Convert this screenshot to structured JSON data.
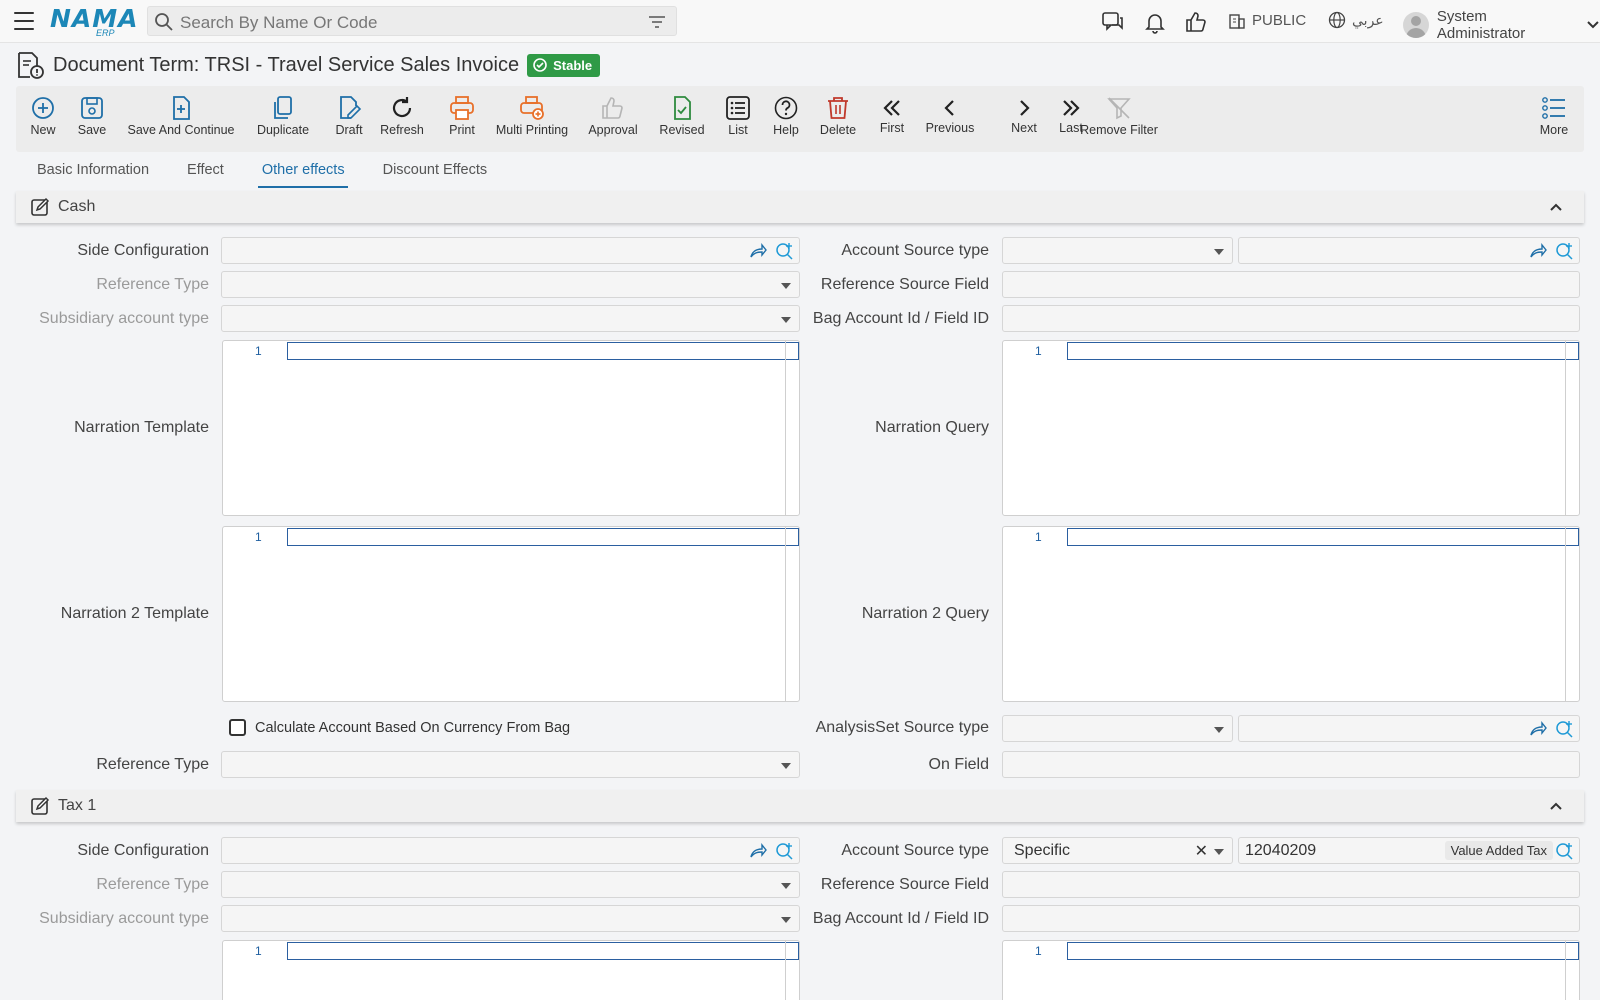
{
  "topbar": {
    "logo_text": "NAMA",
    "logo_sub": "ERP",
    "search_placeholder": "Search By Name Or Code",
    "company": "PUBLIC",
    "language": "عربي",
    "user_name": "System Administrator"
  },
  "page": {
    "title": "Document Term: TRSI - Travel Service Sales Invoice",
    "status": "Stable"
  },
  "toolbar": {
    "new": "New",
    "save": "Save",
    "save_continue": "Save And Continue",
    "duplicate": "Duplicate",
    "draft": "Draft",
    "refresh": "Refresh",
    "print": "Print",
    "multi_printing": "Multi Printing",
    "approval": "Approval",
    "revised": "Revised",
    "list": "List",
    "help": "Help",
    "delete": "Delete",
    "first": "First",
    "previous": "Previous",
    "next": "Next",
    "last": "Last",
    "remove_filter": "Remove Filter",
    "more": "More"
  },
  "tabs": [
    "Basic Information",
    "Effect",
    "Other effects",
    "Discount Effects"
  ],
  "cash": {
    "title": "Cash",
    "side_configuration": "Side Configuration",
    "reference_type": "Reference Type",
    "subsidiary_account_type": "Subsidiary account type",
    "narration_template": "Narration Template",
    "narration2_template": "Narration 2 Template",
    "calc_account_currency": "Calculate Account Based On Currency From Bag",
    "reference_type_2": "Reference Type",
    "account_source_type": "Account Source type",
    "reference_source_field": "Reference Source Field",
    "bag_account_id": "Bag Account Id / Field ID",
    "narration_query": "Narration Query",
    "narration2_query": "Narration 2 Query",
    "analysis_set_source_type": "AnalysisSet Source type",
    "on_field": "On Field",
    "line_no": "1"
  },
  "tax1": {
    "title": "Tax 1",
    "side_configuration": "Side Configuration",
    "reference_type": "Reference Type",
    "subsidiary_account_type": "Subsidiary account type",
    "account_source_type": "Account Source type",
    "account_source_value": "Specific",
    "account_code": "12040209",
    "account_name": "Value Added Tax",
    "reference_source_field": "Reference Source Field",
    "bag_account_id": "Bag Account Id / Field ID",
    "line_no": "1"
  },
  "colors": {
    "accent": "#1f6fa8",
    "stable_badge": "#2f9a46",
    "print_orange": "#e8702a",
    "delete_red": "#c0392b",
    "revised_green": "#2e8b3e"
  }
}
